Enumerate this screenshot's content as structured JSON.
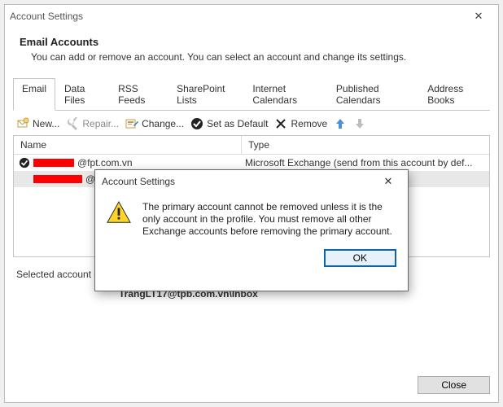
{
  "window": {
    "title": "Account Settings",
    "close_glyph": "✕"
  },
  "header": {
    "title": "Email Accounts",
    "subtitle": "You can add or remove an account. You can select an account and change its settings."
  },
  "tabs": {
    "items": [
      {
        "label": "Email",
        "active": true
      },
      {
        "label": "Data Files",
        "active": false
      },
      {
        "label": "RSS Feeds",
        "active": false
      },
      {
        "label": "SharePoint Lists",
        "active": false
      },
      {
        "label": "Internet Calendars",
        "active": false
      },
      {
        "label": "Published Calendars",
        "active": false
      },
      {
        "label": "Address Books",
        "active": false
      }
    ]
  },
  "toolbar": {
    "new_label": "New...",
    "repair_label": "Repair...",
    "change_label": "Change...",
    "default_label": "Set as Default",
    "remove_label": "Remove"
  },
  "list": {
    "col_name": "Name",
    "col_type": "Type",
    "rows": [
      {
        "suffix": "@fpt.com.vn",
        "type": "Microsoft Exchange (send from this account by def...",
        "default": true,
        "selected": false
      },
      {
        "suffix": "@tpb",
        "type": "",
        "default": false,
        "selected": true
      }
    ]
  },
  "below": {
    "line": "Selected account delivers new messages to the following location:",
    "path": "TrangLT17@tpb.com.vn\\Inbox"
  },
  "footer": {
    "close_label": "Close"
  },
  "modal": {
    "title": "Account Settings",
    "message": "The primary account cannot be removed unless it is the only account in the profile. You must remove all other Exchange accounts before removing the primary account.",
    "ok_label": "OK",
    "close_glyph": "✕"
  }
}
